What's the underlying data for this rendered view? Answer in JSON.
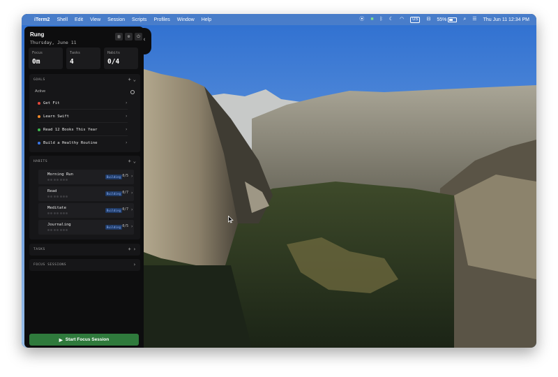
{
  "menubar": {
    "app_name": "iTerm2",
    "menus": [
      "Shell",
      "Edit",
      "View",
      "Session",
      "Scripts",
      "Profiles",
      "Window",
      "Help"
    ],
    "battery_percent": "55%",
    "datetime": "Thu Jun 11  12:34 PM",
    "keyboard_badge": "US"
  },
  "panel": {
    "title": "Rung",
    "date": "Thursday, June 11",
    "stats": [
      {
        "label": "Focus",
        "value": "0m"
      },
      {
        "label": "Tasks",
        "value": "4"
      },
      {
        "label": "Habits",
        "value": "0/4"
      }
    ],
    "goals": {
      "heading": "GOALS",
      "subheading": "Active",
      "items": [
        {
          "label": "Get Fit",
          "color": "#e5483b"
        },
        {
          "label": "Learn Swift",
          "color": "#f08a2a"
        },
        {
          "label": "Read 12 Books This Year",
          "color": "#3fb950"
        },
        {
          "label": "Build a Healthy Routine",
          "color": "#3b78e7"
        }
      ]
    },
    "habits": {
      "heading": "HABITS",
      "items": [
        {
          "name": "Morning Run",
          "status": "Building",
          "count": "0/5",
          "streak_filled": 0,
          "streak_total": 7
        },
        {
          "name": "Read",
          "status": "Building",
          "count": "0/7",
          "streak_filled": 0,
          "streak_total": 7
        },
        {
          "name": "Meditate",
          "status": "Building",
          "count": "0/7",
          "streak_filled": 0,
          "streak_total": 7
        },
        {
          "name": "Journaling",
          "status": "Building",
          "count": "0/5",
          "streak_filled": 0,
          "streak_total": 7
        }
      ]
    },
    "tasks": {
      "heading": "TASKS"
    },
    "focus_sessions": {
      "heading": "FOCUS SESSIONS"
    },
    "start_button": "Start Focus Session"
  },
  "colors": {
    "accent_green": "#2f7a3c",
    "badge_blue": "#1f3a66",
    "panel_bg": "#0d0d0e"
  }
}
